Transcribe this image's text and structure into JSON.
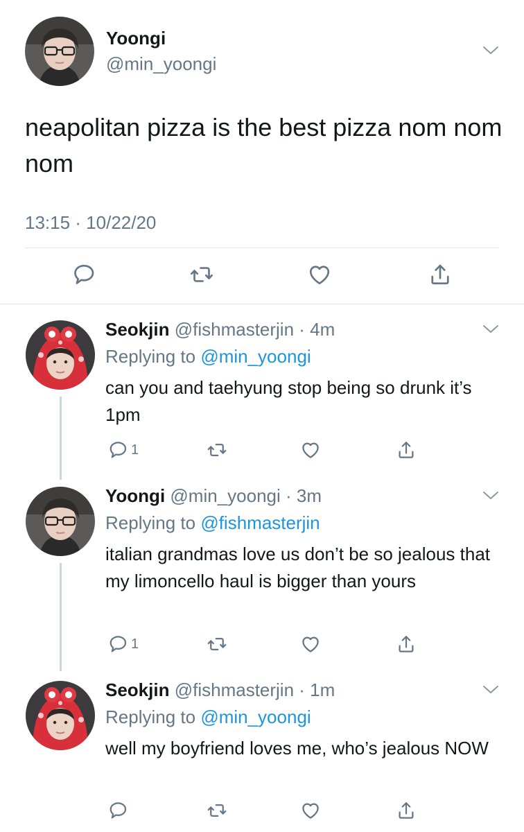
{
  "main_tweet": {
    "name": "Yoongi",
    "handle": "@min_yoongi",
    "text": "neapolitan pizza is the best pizza nom nom nom",
    "timestamp": "13:15 · 10/22/20",
    "icons": {
      "reply": "comment-icon",
      "retweet": "retweet-icon",
      "like": "heart-icon",
      "share": "share-icon",
      "menu": "chevron-down-icon"
    }
  },
  "replies": [
    {
      "name": "Seokjin",
      "handle_time": "@fishmasterjin · 4m",
      "replying_prefix": "Replying to",
      "replying_to": "@min_yoongi",
      "text": "can you and taehyung stop being so drunk it’s 1pm",
      "reply_count": "1"
    },
    {
      "name": "Yoongi",
      "handle_time": "@min_yoongi · 3m",
      "replying_prefix": "Replying to",
      "replying_to": "@fishmasterjin",
      "text": "italian grandmas love us don’t be so jealous that my limoncello haul is bigger than yours",
      "reply_count": "1"
    },
    {
      "name": "Seokjin",
      "handle_time": "@fishmasterjin · 1m",
      "replying_prefix": "Replying to",
      "replying_to": "@min_yoongi",
      "text": "well my boyfriend loves me, who’s jealous NOW",
      "reply_count": ""
    }
  ],
  "colors": {
    "text": "#14171a",
    "secondary": "#657786",
    "link": "#1b95e0",
    "divider": "#e1e8ed",
    "thread_line": "#ccd6dd"
  }
}
